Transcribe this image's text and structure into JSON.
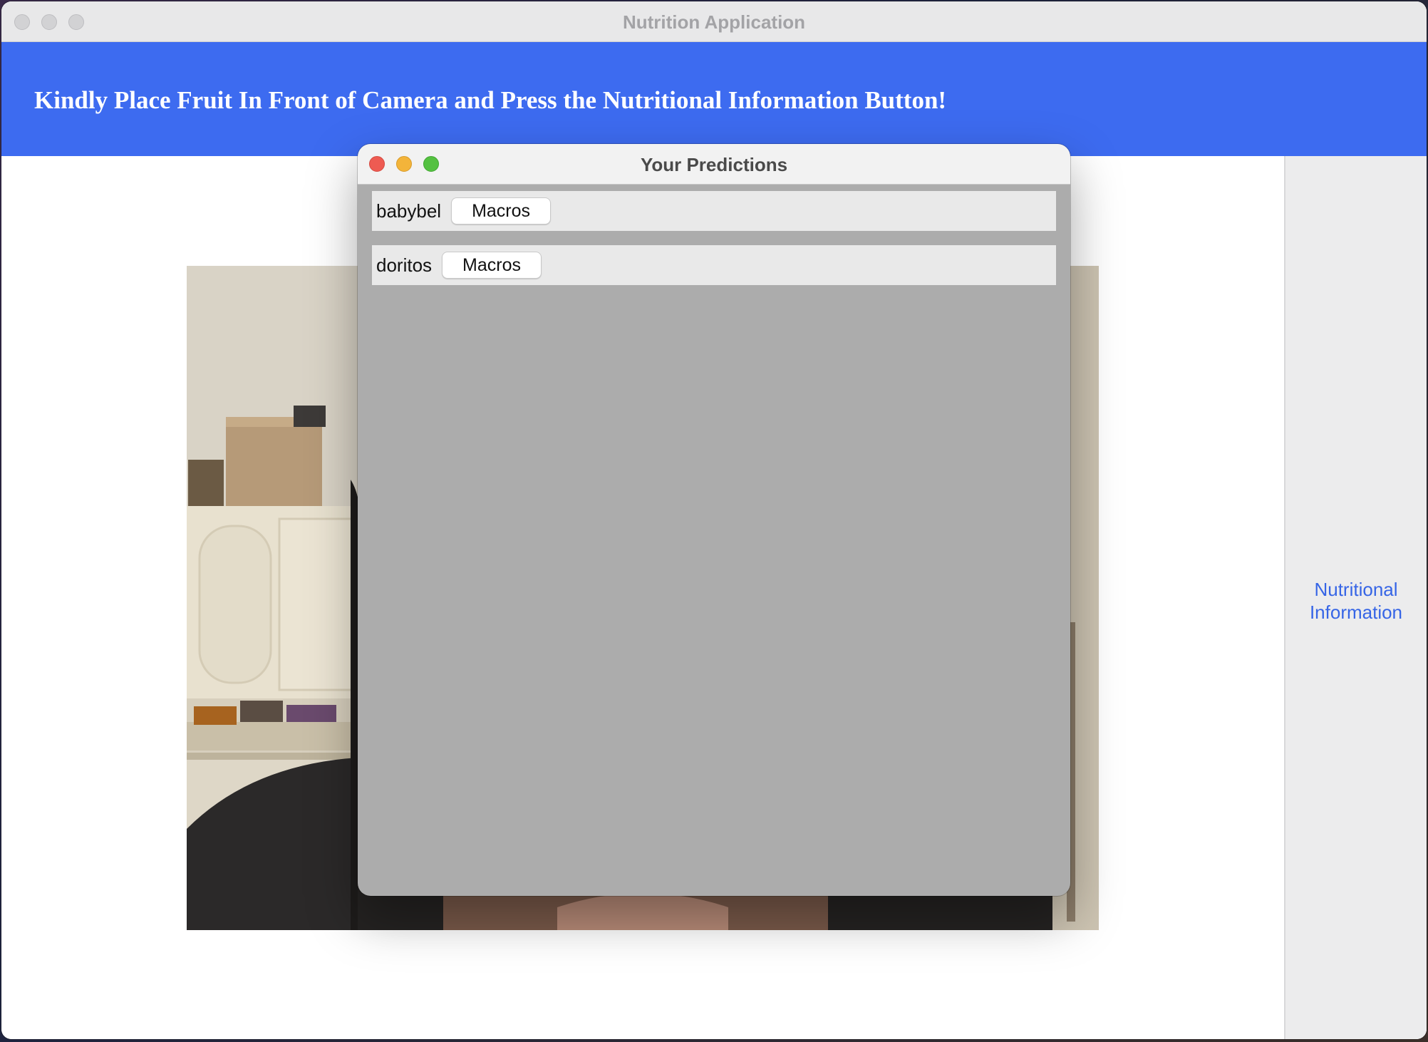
{
  "app": {
    "window_title": "Nutrition Application",
    "banner_heading": "Kindly Place Fruit In Front of Camera and Press the Nutritional Information Button!",
    "nutrition_button_label": "Nutritional Information"
  },
  "predictions_window": {
    "title": "Your Predictions",
    "items": [
      {
        "name": "babybel",
        "button_label": "Macros"
      },
      {
        "name": "doritos",
        "button_label": "Macros"
      }
    ]
  },
  "colors": {
    "banner": "#3d6bf0",
    "link": "#3665e6",
    "predictions_background": "#acacac"
  }
}
